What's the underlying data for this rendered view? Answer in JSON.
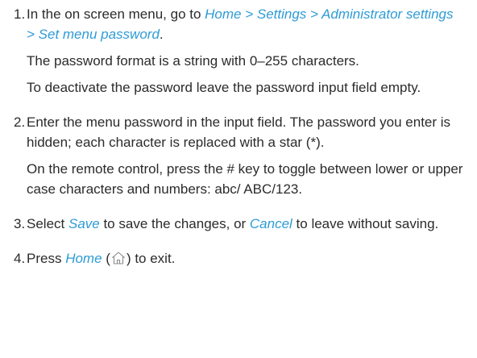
{
  "steps": [
    {
      "num": "1.",
      "intro": "In the on screen menu, go to ",
      "path": "Home > Settings > Administrator settings > Set menu password",
      "intro_end": ".",
      "p2": "The password format is a string with 0–255 characters.",
      "p3": "To deactivate the password leave the password input field empty."
    },
    {
      "num": "2.",
      "p1": "Enter the menu password in the input field. The password you enter is hidden; each character is replaced with a star (*).",
      "p2": "On the remote control, press the # key to toggle between lower or upper case characters and numbers: abc/ ABC/123."
    },
    {
      "num": "3.",
      "t1": "Select ",
      "save": "Save",
      "t2": " to save the changes, or ",
      "cancel": "Cancel",
      "t3": " to leave without saving."
    },
    {
      "num": "4.",
      "t1": "Press ",
      "home": "Home",
      "t2": " (",
      "icon": "home-icon",
      "t3": ") to exit."
    }
  ],
  "colors": {
    "text": "#2b2b2b",
    "link": "#2e9bd6"
  }
}
